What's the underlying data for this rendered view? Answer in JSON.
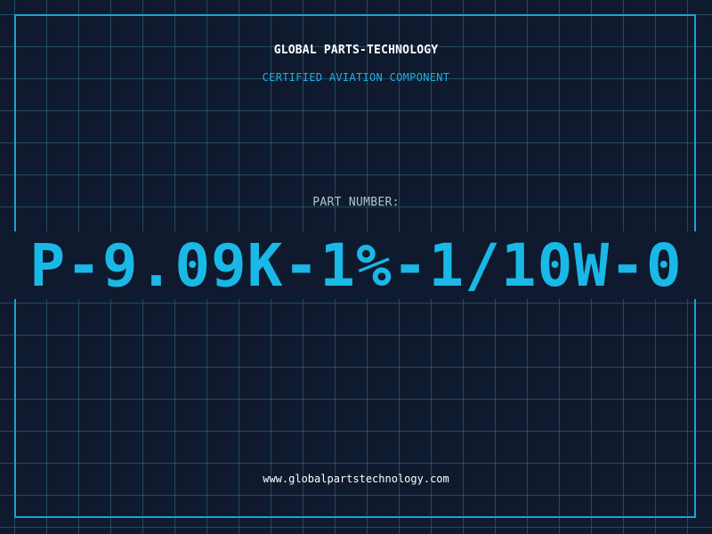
{
  "header": {
    "company_name": "GLOBAL PARTS-TECHNOLOGY",
    "tagline": "CERTIFIED AVIATION COMPONENT"
  },
  "part": {
    "label": "PART NUMBER:",
    "number": "P-9.09K-1%-1/10W-0"
  },
  "footer": {
    "website": "www.globalpartstechnology.com"
  },
  "colors": {
    "background": "#0f1a2e",
    "grid": "#346e8c",
    "accent": "#1ab8e6",
    "border": "#1ba3d4",
    "label": "#b7c3d0",
    "heading": "#ffffff"
  }
}
